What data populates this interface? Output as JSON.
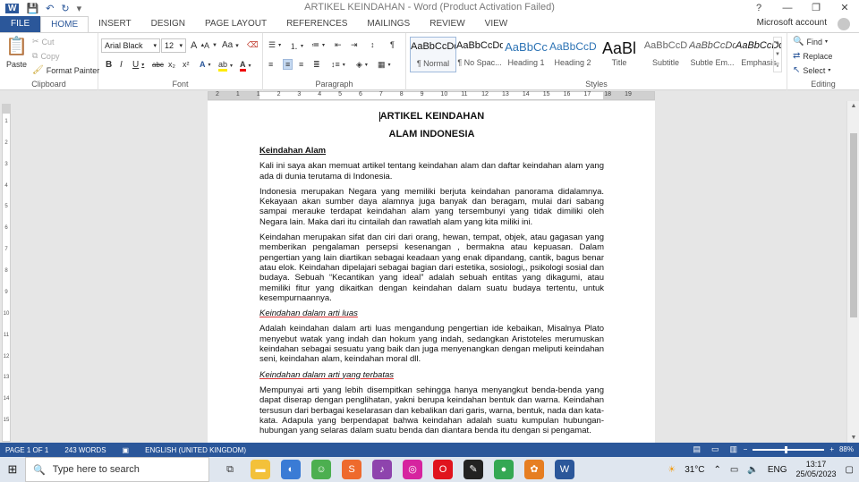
{
  "titlebar": {
    "title": "ARTIKEL KEINDAHAN - Word (Product Activation Failed)",
    "help": "?",
    "minimize": "—",
    "restore": "❐",
    "close": "✕"
  },
  "tabs": {
    "file": "FILE",
    "home": "HOME",
    "insert": "INSERT",
    "design": "DESIGN",
    "page_layout": "PAGE LAYOUT",
    "references": "REFERENCES",
    "mailings": "MAILINGS",
    "review": "REVIEW",
    "view": "VIEW",
    "account": "Microsoft account"
  },
  "clipboard": {
    "paste": "Paste",
    "cut": "Cut",
    "copy": "Copy",
    "format_painter": "Format Painter",
    "label": "Clipboard"
  },
  "font": {
    "family": "Arial Black",
    "size": "12",
    "grow": "A",
    "shrink": "A",
    "case": "Aa",
    "bold": "B",
    "italic": "I",
    "underline": "U",
    "strike": "abc",
    "subscript": "x₂",
    "superscript": "x²",
    "label": "Font"
  },
  "paragraph": {
    "label": "Paragraph"
  },
  "styles": {
    "label": "Styles",
    "items": [
      {
        "sample": "AaBbCcDd",
        "name": "¶ Normal"
      },
      {
        "sample": "AaBbCcDd",
        "name": "¶ No Spac..."
      },
      {
        "sample": "AaBbCc",
        "name": "Heading 1"
      },
      {
        "sample": "AaBbCcD",
        "name": "Heading 2"
      },
      {
        "sample": "AaBl",
        "name": "Title"
      },
      {
        "sample": "AaBbCcD",
        "name": "Subtitle"
      },
      {
        "sample": "AaBbCcDd",
        "name": "Subtle Em..."
      },
      {
        "sample": "AaBbCcDd",
        "name": "Emphasis"
      }
    ]
  },
  "editing": {
    "find": "Find",
    "replace": "Replace",
    "select": "Select",
    "label": "Editing"
  },
  "ruler": {
    "ticks": [
      "2",
      "1",
      "1",
      "2",
      "3",
      "4",
      "5",
      "6",
      "7",
      "8",
      "9",
      "10",
      "11",
      "12",
      "13",
      "14",
      "15",
      "16",
      "17",
      "18",
      "19"
    ]
  },
  "vruler": {
    "ticks": [
      "1",
      "2",
      "3",
      "4",
      "5",
      "6",
      "7",
      "8",
      "9",
      "10",
      "11",
      "12",
      "13",
      "14",
      "15"
    ]
  },
  "document": {
    "title1": "ARTIKEL KEINDAHAN",
    "title2": "ALAM INDONESIA",
    "section1": "Keindahan Alam",
    "p1": "Kali ini saya akan memuat artikel tentang keindahan alam dan daftar keindahan alam yang ada di dunia terutama di Indonesia.",
    "p2": "Indonesia merupakan Negara yang memiliki berjuta keindahan panorama didalamnya. Kekayaan akan sumber daya alamnya juga banyak dan beragam, mulai dari sabang sampai merauke terdapat keindahan alam yang tersembunyi yang tidak dimiliki oleh Negara lain. Maka dari itu cintailah dan rawatlah alam yang kita miliki ini.",
    "p3": "Keindahan merupakan sifat dan ciri dari orang, hewan, tempat, objek, atau gagasan yang memberikan pengalaman persepsi kesenangan , bermakna atau kepuasan. Dalam pengertian yang lain diartikan sebagai keadaan yang enak dipandang, cantik, bagus benar atau elok. Keindahan dipelajari sebagai bagian dari estetika, sosiologi,, psikologi sosial dan budaya. Sebuah “Kecantikan yang ideal” adalah sebuah entitas yang dikagumi, atau memiliki fitur yang dikaitkan dengan keindahan dalam suatu budaya tertentu, untuk kesempurnaannya.",
    "sub1": "Keindahan dalam arti luas",
    "p4": "Adalah keindahan dalam arti luas mengandung pengertian ide kebaikan, Misalnya Plato menyebut watak yang indah dan hokum yang indah, sedangkan Aristoteles merumuskan keindahan sebagai sesuatu yang baik dan juga menyenangkan dengan meliputi keindahan seni, keindahan alam, keindahan moral dll.",
    "sub2": "Keindahan dalam arti yang terbatas",
    "p5": "Mempunyai arti yang lebih disempitkan sehingga hanya menyangkut benda-benda yang dapat diserap dengan penglihatan, yakni berupa keindahan bentuk dan warna. Keindahan tersusun dari berbagai keselarasan dan kebalikan dari garis, warna, bentuk, nada dan kata-kata. Adapula yang berpendapat bahwa keindahan adalah suatu kumpulan hubungan-hubungan yang selaras dalam suatu benda dan diantara benda itu dengan si pengamat."
  },
  "status": {
    "page": "PAGE 1 OF 1",
    "words": "243 WORDS",
    "language": "ENGLISH (UNITED KINGDOM)",
    "zoom": "88%",
    "zoom_minus": "−",
    "zoom_plus": "+"
  },
  "taskbar": {
    "search_placeholder": "Type here to search",
    "temperature": "31°C",
    "lang": "ENG",
    "time": "13:17",
    "date": "25/05/2023"
  },
  "colors": {
    "word_blue": "#2b579a",
    "spell_red": "#d33333"
  }
}
